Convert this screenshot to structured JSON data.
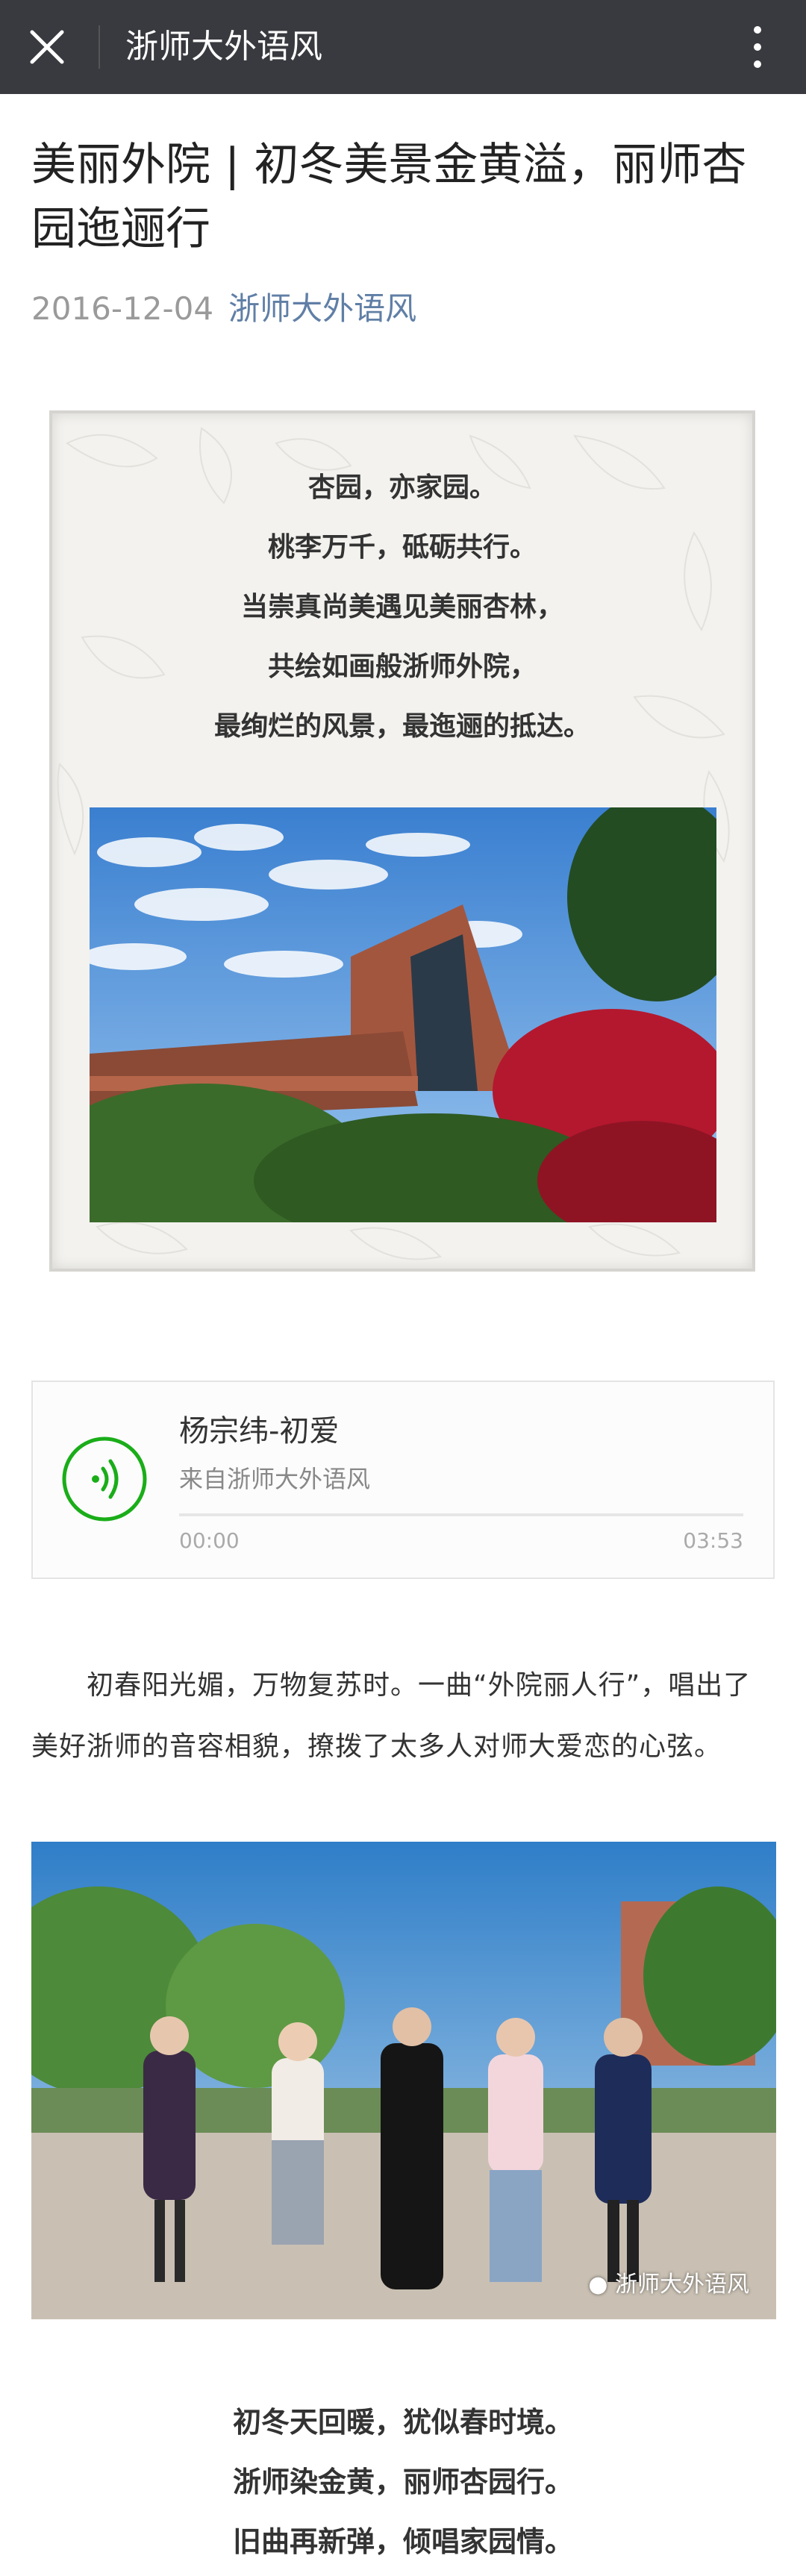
{
  "topbar": {
    "title": "浙师大外语风"
  },
  "article": {
    "title": "美丽外院 | 初冬美景金黄溢，丽师杏园迤逦行",
    "date": "2016-12-04",
    "account": "浙师大外语风"
  },
  "poem_card": {
    "lines": [
      "杏园，亦家园。",
      "桃李万千，砥砺共行。",
      "当崇真尚美遇见美丽杏林，",
      "共绘如画般浙师外院，",
      "最绚烂的风景，最迤逦的抵达。"
    ]
  },
  "audio": {
    "song": "杨宗纬-初爱",
    "source": "来自浙师大外语风",
    "time_current": "00:00",
    "time_total": "03:53",
    "progress": 0,
    "accent": "#1aad19"
  },
  "paragraph": "初春阳光媚，万物复苏时。一曲“外院丽人行”，唱出了美好浙师的音容相貌，撩拨了太多人对师大爱恋的心弦。",
  "group_photo": {
    "watermark": "浙师大外语风"
  },
  "poem2": {
    "lines": [
      "初冬天回暖，犹似春时境。",
      "浙师染金黄，丽师杏园行。",
      "旧曲再新弹，倾唱家园情。"
    ]
  },
  "icons": [
    "close-icon",
    "more-icon",
    "audio-play-icon",
    "wechat-logo-icon"
  ]
}
